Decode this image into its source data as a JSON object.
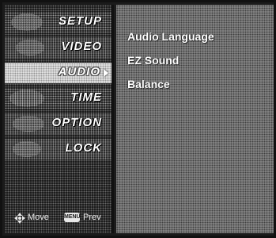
{
  "menu": {
    "items": [
      {
        "label": "SETUP",
        "selected": false
      },
      {
        "label": "VIDEO",
        "selected": false
      },
      {
        "label": "AUDIO",
        "selected": true
      },
      {
        "label": "TIME",
        "selected": false
      },
      {
        "label": "OPTION",
        "selected": false
      },
      {
        "label": "LOCK",
        "selected": false
      }
    ]
  },
  "submenu": {
    "items": [
      {
        "label": "Audio Language"
      },
      {
        "label": "EZ Sound"
      },
      {
        "label": "Balance"
      }
    ]
  },
  "footer": {
    "move_label": "Move",
    "menu_key_label": "MENU",
    "prev_label": "Prev"
  },
  "icons": {
    "selected_arrow": "triangle-right-icon",
    "navigation": "four-way-arrow-icon",
    "menu_key": "menu-button-icon"
  },
  "colors": {
    "menu_background": "#151515",
    "submenu_background": "#8a8a8a",
    "selected_background": "#e9e9e9",
    "text": "#ffffff"
  }
}
